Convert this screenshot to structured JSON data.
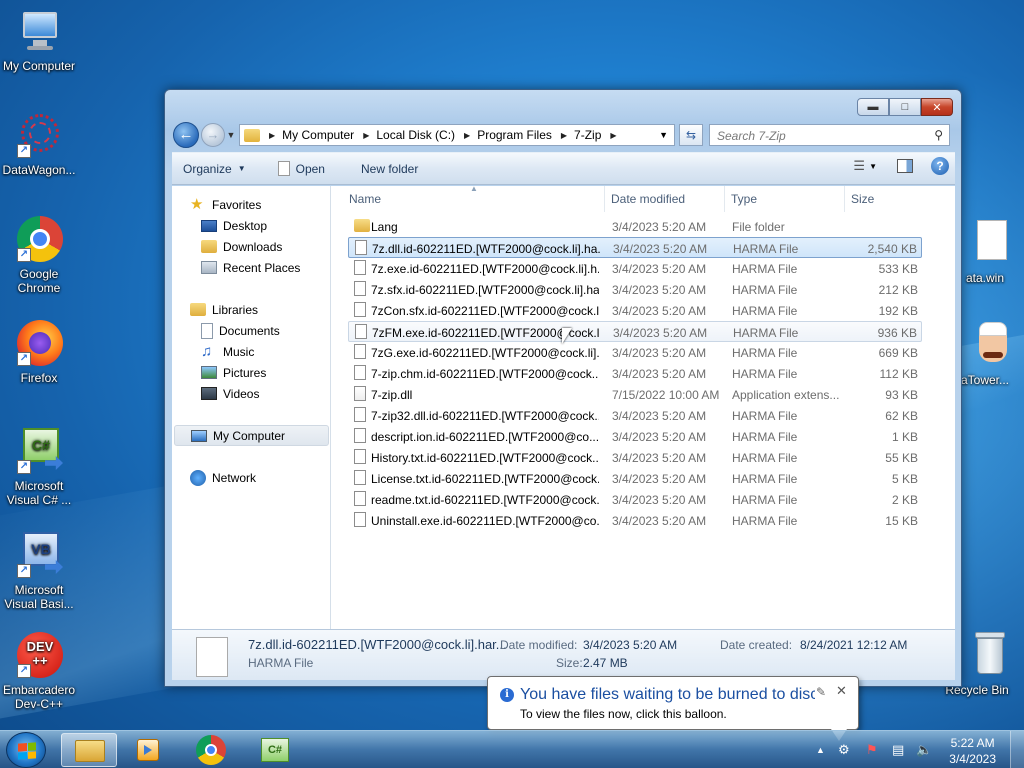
{
  "desktop": {
    "icons": [
      {
        "label": "My Computer",
        "icon": "computer-icon"
      },
      {
        "label": "DataWagon...",
        "icon": "datawagon-icon"
      },
      {
        "label": "Google Chrome",
        "icon": "chrome-icon"
      },
      {
        "label": "Firefox",
        "icon": "firefox-icon"
      },
      {
        "label": "Microsoft Visual C# ...",
        "icon": "visual-csharp-icon"
      },
      {
        "label": "Microsoft Visual Basi...",
        "icon": "visual-basic-icon"
      },
      {
        "label": "Embarcadero Dev-C++",
        "icon": "devcpp-icon"
      },
      {
        "label": "ata.win",
        "icon": "file-icon"
      },
      {
        "label": "aTower...",
        "icon": "tower-game-icon"
      },
      {
        "label": "Recycle Bin",
        "icon": "recycle-bin-icon"
      }
    ],
    "devcpp_badge": "DEV\n++",
    "csharp_badge": "C#",
    "vb_badge": "VB"
  },
  "explorer": {
    "breadcrumb": [
      "My Computer",
      "Local Disk (C:)",
      "Program Files",
      "7-Zip"
    ],
    "search_placeholder": "Search 7-Zip",
    "toolbar": {
      "organize": "Organize",
      "open": "Open",
      "new_folder": "New folder"
    },
    "nav": {
      "favorites": "Favorites",
      "desktop": "Desktop",
      "downloads": "Downloads",
      "recent_places": "Recent Places",
      "libraries": "Libraries",
      "documents": "Documents",
      "music": "Music",
      "pictures": "Pictures",
      "videos": "Videos",
      "my_computer": "My Computer",
      "network": "Network"
    },
    "columns": {
      "name": "Name",
      "date": "Date modified",
      "type": "Type",
      "size": "Size"
    },
    "files": [
      {
        "name": "Lang",
        "date": "3/4/2023 5:20 AM",
        "type": "File folder",
        "size": "",
        "kind": "folder"
      },
      {
        "name": "7z.dll.id-602211ED.[WTF2000@cock.li].ha...",
        "date": "3/4/2023 5:20 AM",
        "type": "HARMA File",
        "size": "2,540 KB",
        "kind": "file"
      },
      {
        "name": "7z.exe.id-602211ED.[WTF2000@cock.li].h...",
        "date": "3/4/2023 5:20 AM",
        "type": "HARMA File",
        "size": "533 KB",
        "kind": "file"
      },
      {
        "name": "7z.sfx.id-602211ED.[WTF2000@cock.li].ha...",
        "date": "3/4/2023 5:20 AM",
        "type": "HARMA File",
        "size": "212 KB",
        "kind": "file"
      },
      {
        "name": "7zCon.sfx.id-602211ED.[WTF2000@cock.l...",
        "date": "3/4/2023 5:20 AM",
        "type": "HARMA File",
        "size": "192 KB",
        "kind": "file"
      },
      {
        "name": "7zFM.exe.id-602211ED.[WTF2000@cock.li...",
        "date": "3/4/2023 5:20 AM",
        "type": "HARMA File",
        "size": "936 KB",
        "kind": "file"
      },
      {
        "name": "7zG.exe.id-602211ED.[WTF2000@cock.li]....",
        "date": "3/4/2023 5:20 AM",
        "type": "HARMA File",
        "size": "669 KB",
        "kind": "file"
      },
      {
        "name": "7-zip.chm.id-602211ED.[WTF2000@cock....",
        "date": "3/4/2023 5:20 AM",
        "type": "HARMA File",
        "size": "112 KB",
        "kind": "file"
      },
      {
        "name": "7-zip.dll",
        "date": "7/15/2022 10:00 AM",
        "type": "Application extens...",
        "size": "93 KB",
        "kind": "dll"
      },
      {
        "name": "7-zip32.dll.id-602211ED.[WTF2000@cock....",
        "date": "3/4/2023 5:20 AM",
        "type": "HARMA File",
        "size": "62 KB",
        "kind": "file"
      },
      {
        "name": "descript.ion.id-602211ED.[WTF2000@co...",
        "date": "3/4/2023 5:20 AM",
        "type": "HARMA File",
        "size": "1 KB",
        "kind": "file"
      },
      {
        "name": "History.txt.id-602211ED.[WTF2000@cock....",
        "date": "3/4/2023 5:20 AM",
        "type": "HARMA File",
        "size": "55 KB",
        "kind": "file"
      },
      {
        "name": "License.txt.id-602211ED.[WTF2000@cock....",
        "date": "3/4/2023 5:20 AM",
        "type": "HARMA File",
        "size": "5 KB",
        "kind": "file"
      },
      {
        "name": "readme.txt.id-602211ED.[WTF2000@cock....",
        "date": "3/4/2023 5:20 AM",
        "type": "HARMA File",
        "size": "2 KB",
        "kind": "file"
      },
      {
        "name": "Uninstall.exe.id-602211ED.[WTF2000@co...",
        "date": "3/4/2023 5:20 AM",
        "type": "HARMA File",
        "size": "15 KB",
        "kind": "file"
      }
    ],
    "details": {
      "name": "7z.dll.id-602211ED.[WTF2000@cock.li].har...",
      "type": "HARMA File",
      "date_modified_label": "Date modified:",
      "date_modified": "3/4/2023 5:20 AM",
      "size_label": "Size:",
      "size": "2.47 MB",
      "date_created_label": "Date created:",
      "date_created": "8/24/2021 12:12 AM"
    }
  },
  "balloon": {
    "title": "You have files waiting to be burned to disc",
    "message": "To view the files now, click this balloon."
  },
  "taskbar": {
    "time": "5:22 AM",
    "date": "3/4/2023",
    "csharp_badge": "C#"
  }
}
